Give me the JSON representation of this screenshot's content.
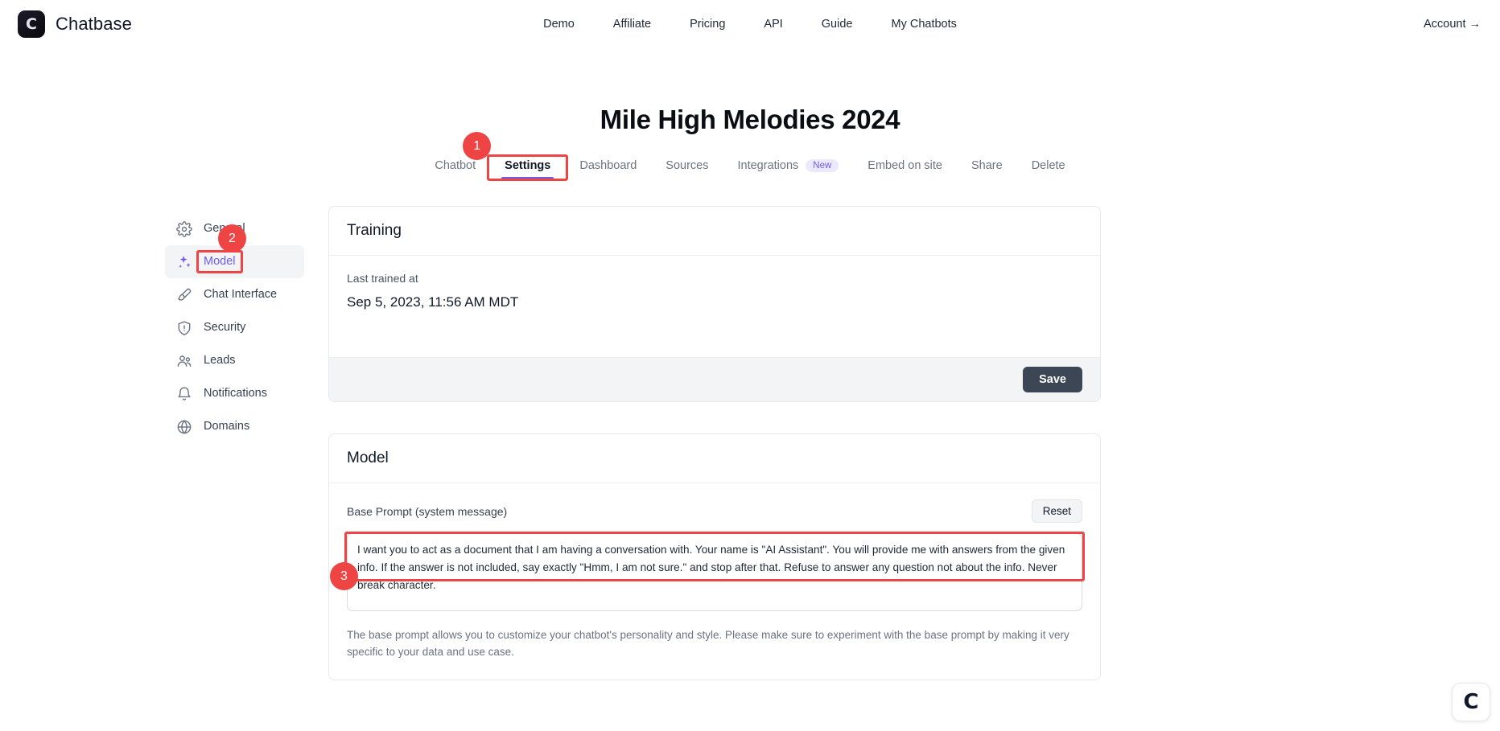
{
  "header": {
    "brand": "Chatbase",
    "logo_glyph": "C",
    "nav": [
      {
        "label": "Demo"
      },
      {
        "label": "Affiliate"
      },
      {
        "label": "Pricing"
      },
      {
        "label": "API"
      },
      {
        "label": "Guide"
      },
      {
        "label": "My Chatbots"
      }
    ],
    "account": "Account →"
  },
  "page": {
    "title": "Mile High Melodies 2024"
  },
  "tabs": [
    {
      "label": "Chatbot",
      "active": false
    },
    {
      "label": "Settings",
      "active": true
    },
    {
      "label": "Dashboard",
      "active": false
    },
    {
      "label": "Sources",
      "active": false
    },
    {
      "label": "Integrations",
      "active": false,
      "badge": "New"
    },
    {
      "label": "Embed on site",
      "active": false
    },
    {
      "label": "Share",
      "active": false
    },
    {
      "label": "Delete",
      "active": false
    }
  ],
  "sidebar": {
    "items": [
      {
        "label": "General",
        "icon": "gear-icon",
        "active": false
      },
      {
        "label": "Model",
        "icon": "sparkles-icon",
        "active": true
      },
      {
        "label": "Chat Interface",
        "icon": "brush-icon",
        "active": false
      },
      {
        "label": "Security",
        "icon": "shield-icon",
        "active": false
      },
      {
        "label": "Leads",
        "icon": "users-icon",
        "active": false
      },
      {
        "label": "Notifications",
        "icon": "bell-icon",
        "active": false
      },
      {
        "label": "Domains",
        "icon": "globe-icon",
        "active": false
      }
    ]
  },
  "training_card": {
    "title": "Training",
    "last_trained_label": "Last trained at",
    "last_trained_value": "Sep 5, 2023, 11:56 AM MDT",
    "save_label": "Save"
  },
  "model_card": {
    "title": "Model",
    "base_prompt_label": "Base Prompt (system message)",
    "reset_label": "Reset",
    "base_prompt_value": "I want you to act as a document that I am having a conversation with. Your name is \"AI Assistant\". You will provide me with answers from the given info. If the answer is not included, say exactly \"Hmm, I am not sure.\" and stop after that. Refuse to answer any question not about the info. Never break character.",
    "help_text": "The base prompt allows you to customize your chatbot's personality and style. Please make sure to experiment with the base prompt by making it very specific to your data and use case."
  },
  "annotations": [
    {
      "number": "1",
      "target": "settings-tab"
    },
    {
      "number": "2",
      "target": "sidebar-item-model"
    },
    {
      "number": "3",
      "target": "base-prompt-textarea"
    }
  ],
  "chat_widget": {
    "glyph": "C"
  },
  "colors": {
    "accent_purple": "#6d5ce7",
    "annotation_red": "#ef4444",
    "save_button": "#3d4654",
    "badge_bg": "#ece9fd"
  }
}
